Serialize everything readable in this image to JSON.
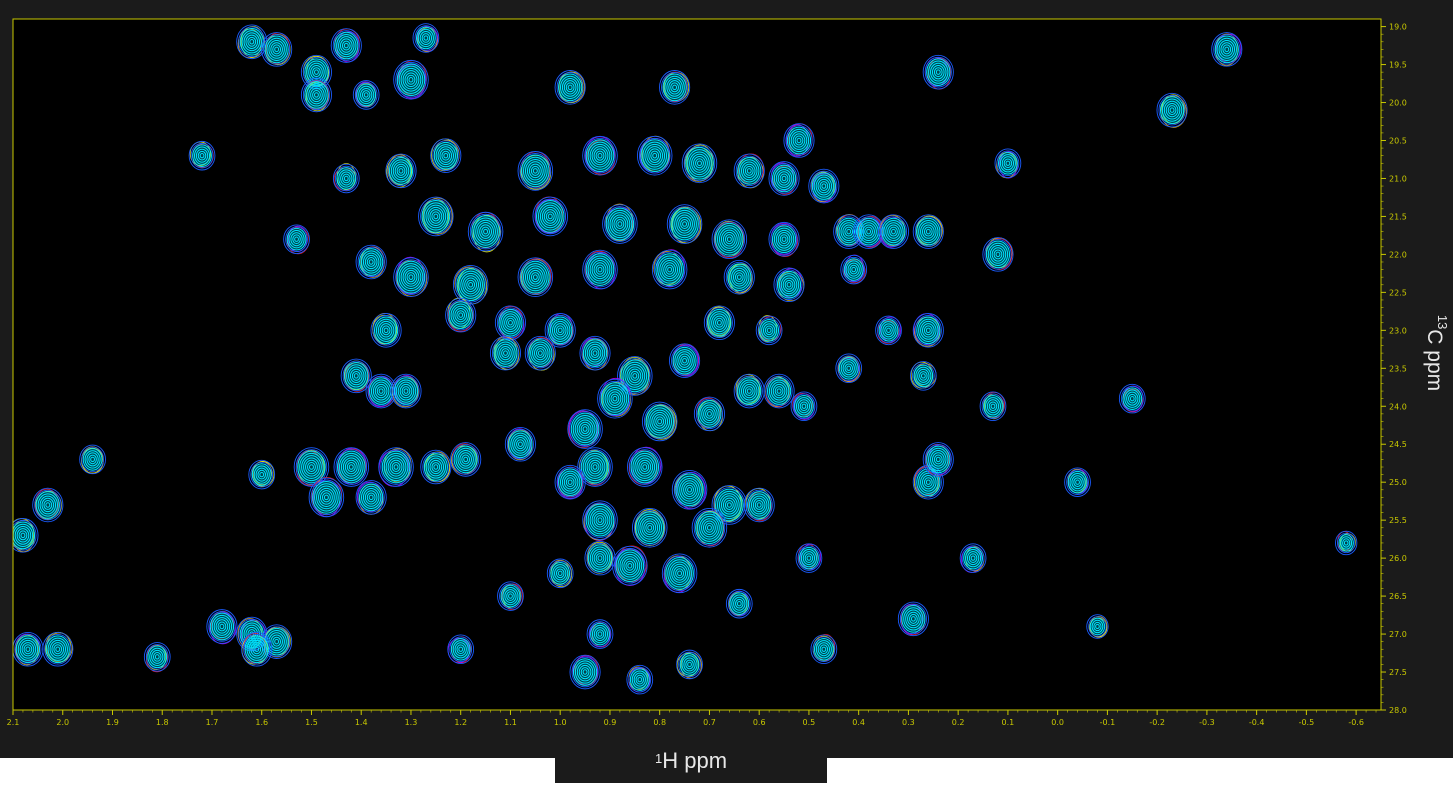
{
  "chart_data": {
    "type": "contour",
    "xlabel": {
      "sup": "1",
      "text": "H ppm"
    },
    "ylabel": {
      "sup": "13",
      "text": "C ppm"
    },
    "xlim": [
      2.1,
      -0.65
    ],
    "ylim": [
      18.9,
      28.0
    ],
    "x_axis_reversed": true,
    "y_axis_inverted": true,
    "x_ticks": [
      "2.1",
      "2.0",
      "1.9",
      "1.8",
      "1.7",
      "1.6",
      "1.5",
      "1.4",
      "1.3",
      "1.2",
      "1.1",
      "1.0",
      "0.9",
      "0.8",
      "0.7",
      "0.6",
      "0.5",
      "0.4",
      "0.3",
      "0.2",
      "0.1",
      "0.0",
      "-0.1",
      "-0.2",
      "-0.3",
      "-0.4",
      "-0.5",
      "-0.6"
    ],
    "y_ticks": [
      "19.0",
      "19.5",
      "20.0",
      "20.5",
      "21.0",
      "21.5",
      "22.0",
      "22.5",
      "23.0",
      "23.5",
      "24.0",
      "24.5",
      "25.0",
      "25.5",
      "26.0",
      "26.5",
      "27.0",
      "27.5",
      "28.0"
    ],
    "background_color": "#000000",
    "axis_color": "#c8c800",
    "contour_colors": [
      "#00e5ff",
      "#1a5cff",
      "#c000ff",
      "#ff1a1a",
      "#ffc000",
      "#ffff00"
    ],
    "peaks": [
      {
        "x": 1.62,
        "y": 19.2,
        "i": 3
      },
      {
        "x": 1.57,
        "y": 19.3,
        "i": 3
      },
      {
        "x": 1.43,
        "y": 19.25,
        "i": 3
      },
      {
        "x": 1.27,
        "y": 19.15,
        "i": 2
      },
      {
        "x": 1.49,
        "y": 19.6,
        "i": 3
      },
      {
        "x": 1.49,
        "y": 19.9,
        "i": 3
      },
      {
        "x": 1.3,
        "y": 19.7,
        "i": 4
      },
      {
        "x": 1.39,
        "y": 19.9,
        "i": 2
      },
      {
        "x": 0.98,
        "y": 19.8,
        "i": 3
      },
      {
        "x": 0.77,
        "y": 19.8,
        "i": 3
      },
      {
        "x": 0.24,
        "y": 19.6,
        "i": 3
      },
      {
        "x": -0.34,
        "y": 19.3,
        "i": 3
      },
      {
        "x": -0.23,
        "y": 20.1,
        "i": 3
      },
      {
        "x": 1.72,
        "y": 20.7,
        "i": 2
      },
      {
        "x": 0.52,
        "y": 20.5,
        "i": 3
      },
      {
        "x": 0.1,
        "y": 20.8,
        "i": 2
      },
      {
        "x": 1.32,
        "y": 20.9,
        "i": 3
      },
      {
        "x": 1.43,
        "y": 21.0,
        "i": 2
      },
      {
        "x": 1.53,
        "y": 21.8,
        "i": 2
      },
      {
        "x": 1.38,
        "y": 22.1,
        "i": 3
      },
      {
        "x": 1.23,
        "y": 20.7,
        "i": 3
      },
      {
        "x": 1.05,
        "y": 20.9,
        "i": 4
      },
      {
        "x": 0.92,
        "y": 20.7,
        "i": 4
      },
      {
        "x": 0.81,
        "y": 20.7,
        "i": 4
      },
      {
        "x": 0.72,
        "y": 20.8,
        "i": 4
      },
      {
        "x": 0.62,
        "y": 20.9,
        "i": 3
      },
      {
        "x": 0.55,
        "y": 21.0,
        "i": 3
      },
      {
        "x": 0.47,
        "y": 21.1,
        "i": 3
      },
      {
        "x": 1.25,
        "y": 21.5,
        "i": 4
      },
      {
        "x": 1.15,
        "y": 21.7,
        "i": 4
      },
      {
        "x": 1.02,
        "y": 21.5,
        "i": 4
      },
      {
        "x": 0.88,
        "y": 21.6,
        "i": 4
      },
      {
        "x": 0.75,
        "y": 21.6,
        "i": 4
      },
      {
        "x": 0.66,
        "y": 21.8,
        "i": 4
      },
      {
        "x": 0.55,
        "y": 21.8,
        "i": 3
      },
      {
        "x": 1.3,
        "y": 22.3,
        "i": 4
      },
      {
        "x": 1.18,
        "y": 22.4,
        "i": 4
      },
      {
        "x": 1.05,
        "y": 22.3,
        "i": 4
      },
      {
        "x": 0.92,
        "y": 22.2,
        "i": 4
      },
      {
        "x": 0.78,
        "y": 22.2,
        "i": 4
      },
      {
        "x": 0.64,
        "y": 22.3,
        "i": 3
      },
      {
        "x": 0.42,
        "y": 21.7,
        "i": 3
      },
      {
        "x": 0.38,
        "y": 21.7,
        "i": 3
      },
      {
        "x": 0.33,
        "y": 21.7,
        "i": 3
      },
      {
        "x": 0.26,
        "y": 21.7,
        "i": 3
      },
      {
        "x": 0.12,
        "y": 22.0,
        "i": 3
      },
      {
        "x": 0.41,
        "y": 22.2,
        "i": 2
      },
      {
        "x": 0.54,
        "y": 22.4,
        "i": 3
      },
      {
        "x": 1.35,
        "y": 23.0,
        "i": 3
      },
      {
        "x": 1.2,
        "y": 22.8,
        "i": 3
      },
      {
        "x": 1.1,
        "y": 22.9,
        "i": 3
      },
      {
        "x": 1.0,
        "y": 23.0,
        "i": 3
      },
      {
        "x": 0.68,
        "y": 22.9,
        "i": 3
      },
      {
        "x": 0.58,
        "y": 23.0,
        "i": 2
      },
      {
        "x": 0.34,
        "y": 23.0,
        "i": 2
      },
      {
        "x": 0.26,
        "y": 23.0,
        "i": 3
      },
      {
        "x": 1.11,
        "y": 23.3,
        "i": 3
      },
      {
        "x": 1.04,
        "y": 23.3,
        "i": 3
      },
      {
        "x": 0.75,
        "y": 23.4,
        "i": 3
      },
      {
        "x": 0.93,
        "y": 23.3,
        "i": 3
      },
      {
        "x": 0.85,
        "y": 23.6,
        "i": 4
      },
      {
        "x": 1.41,
        "y": 23.6,
        "i": 3
      },
      {
        "x": 1.36,
        "y": 23.8,
        "i": 3
      },
      {
        "x": 1.31,
        "y": 23.8,
        "i": 3
      },
      {
        "x": 0.62,
        "y": 23.8,
        "i": 3
      },
      {
        "x": 0.56,
        "y": 23.8,
        "i": 3
      },
      {
        "x": 0.51,
        "y": 24.0,
        "i": 2
      },
      {
        "x": 0.42,
        "y": 23.5,
        "i": 2
      },
      {
        "x": 0.27,
        "y": 23.6,
        "i": 2
      },
      {
        "x": 0.13,
        "y": 24.0,
        "i": 2
      },
      {
        "x": -0.15,
        "y": 23.9,
        "i": 2
      },
      {
        "x": 0.89,
        "y": 23.9,
        "i": 4
      },
      {
        "x": 0.8,
        "y": 24.2,
        "i": 4
      },
      {
        "x": 0.7,
        "y": 24.1,
        "i": 3
      },
      {
        "x": 0.95,
        "y": 24.3,
        "i": 4
      },
      {
        "x": 1.08,
        "y": 24.5,
        "i": 3
      },
      {
        "x": 1.94,
        "y": 24.7,
        "i": 2
      },
      {
        "x": 1.5,
        "y": 24.8,
        "i": 4
      },
      {
        "x": 1.42,
        "y": 24.8,
        "i": 4
      },
      {
        "x": 1.33,
        "y": 24.8,
        "i": 4
      },
      {
        "x": 1.25,
        "y": 24.8,
        "i": 3
      },
      {
        "x": 1.19,
        "y": 24.7,
        "i": 3
      },
      {
        "x": 1.47,
        "y": 25.2,
        "i": 4
      },
      {
        "x": 1.38,
        "y": 25.2,
        "i": 3
      },
      {
        "x": 1.6,
        "y": 24.9,
        "i": 2
      },
      {
        "x": 0.93,
        "y": 24.8,
        "i": 4
      },
      {
        "x": 0.83,
        "y": 24.8,
        "i": 4
      },
      {
        "x": 0.74,
        "y": 25.1,
        "i": 4
      },
      {
        "x": 0.66,
        "y": 25.3,
        "i": 4
      },
      {
        "x": 0.6,
        "y": 25.3,
        "i": 3
      },
      {
        "x": 0.98,
        "y": 25.0,
        "i": 3
      },
      {
        "x": 0.92,
        "y": 25.5,
        "i": 4
      },
      {
        "x": 0.82,
        "y": 25.6,
        "i": 4
      },
      {
        "x": 0.7,
        "y": 25.6,
        "i": 4
      },
      {
        "x": 0.86,
        "y": 26.1,
        "i": 4
      },
      {
        "x": 0.76,
        "y": 26.2,
        "i": 4
      },
      {
        "x": 0.92,
        "y": 26.0,
        "i": 3
      },
      {
        "x": 0.26,
        "y": 25.0,
        "i": 3
      },
      {
        "x": 0.24,
        "y": 24.7,
        "i": 3
      },
      {
        "x": -0.04,
        "y": 25.0,
        "i": 2
      },
      {
        "x": 2.08,
        "y": 25.7,
        "i": 3
      },
      {
        "x": 2.03,
        "y": 25.3,
        "i": 3
      },
      {
        "x": 0.5,
        "y": 26.0,
        "i": 2
      },
      {
        "x": 0.17,
        "y": 26.0,
        "i": 2
      },
      {
        "x": 1.0,
        "y": 26.2,
        "i": 2
      },
      {
        "x": 1.1,
        "y": 26.5,
        "i": 2
      },
      {
        "x": 0.29,
        "y": 26.8,
        "i": 3
      },
      {
        "x": 0.64,
        "y": 26.6,
        "i": 2
      },
      {
        "x": -0.08,
        "y": 26.9,
        "i": 1
      },
      {
        "x": -0.58,
        "y": 25.8,
        "i": 1
      },
      {
        "x": 1.68,
        "y": 26.9,
        "i": 3
      },
      {
        "x": 1.62,
        "y": 27.0,
        "i": 3
      },
      {
        "x": 1.57,
        "y": 27.1,
        "i": 3
      },
      {
        "x": 1.61,
        "y": 27.2,
        "i": 3
      },
      {
        "x": 1.2,
        "y": 27.2,
        "i": 2
      },
      {
        "x": 2.07,
        "y": 27.2,
        "i": 3
      },
      {
        "x": 2.01,
        "y": 27.2,
        "i": 3
      },
      {
        "x": 1.81,
        "y": 27.3,
        "i": 2
      },
      {
        "x": 0.95,
        "y": 27.5,
        "i": 3
      },
      {
        "x": 0.84,
        "y": 27.6,
        "i": 2
      },
      {
        "x": 0.74,
        "y": 27.4,
        "i": 2
      },
      {
        "x": 0.47,
        "y": 27.2,
        "i": 2
      },
      {
        "x": 0.92,
        "y": 27.0,
        "i": 2
      }
    ]
  }
}
